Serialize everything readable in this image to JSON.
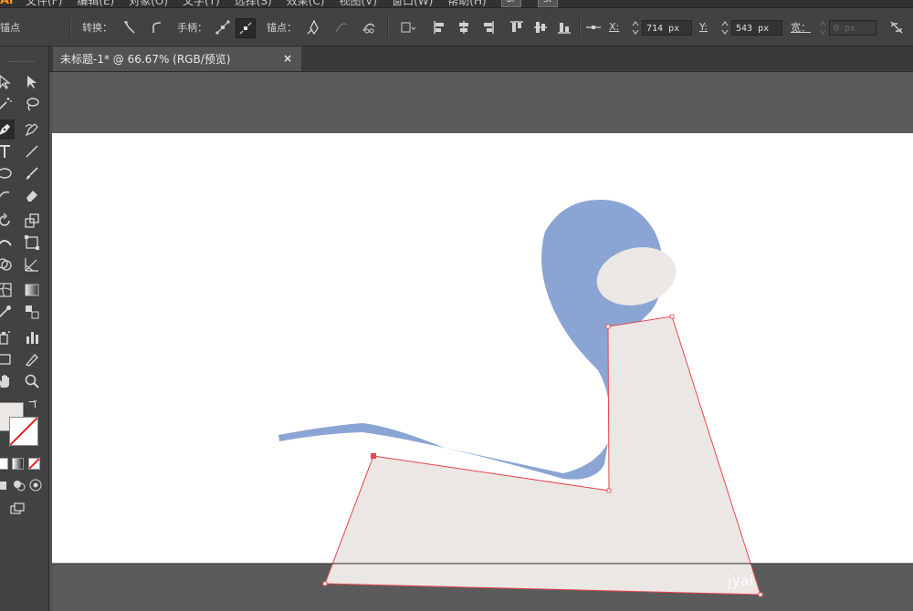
{
  "app": {
    "logo": "Ai",
    "menu": [
      "文件(F)",
      "编辑(E)",
      "对象(O)",
      "文字(T)",
      "选择(S)",
      "效果(C)",
      "视图(V)",
      "窗口(W)",
      "帮助(H)"
    ],
    "bridge_labels": [
      "Br",
      "St"
    ]
  },
  "control_bar": {
    "context_label": "锚点",
    "convert_label": "转换：",
    "handles_label": "手柄：",
    "anchors_label": "锚点：",
    "x_label": "X:",
    "x_value": "714 px",
    "y_label": "Y:",
    "y_value": "543 px",
    "w_label": "宽：",
    "w_value": "0 px"
  },
  "document": {
    "tab_title": "未标题-1* @ 66.67% (RGB/预览)",
    "close_glyph": "×"
  },
  "watermark": "jyai",
  "colors": {
    "blue_shape": "#8aa5d4",
    "light_shape": "#ebe7e4",
    "path_selection": "#e8454f",
    "app_bg": "#535353",
    "panel_bg": "#424242",
    "artboard": "#ffffff"
  },
  "icons": {
    "selection": "selection-arrow-icon",
    "direct_selection": "direct-selection-arrow-icon",
    "pen": "pen-tool-icon",
    "type": "type-tool-icon",
    "hand": "hand-tool-icon",
    "zoom": "zoom-tool-icon"
  }
}
